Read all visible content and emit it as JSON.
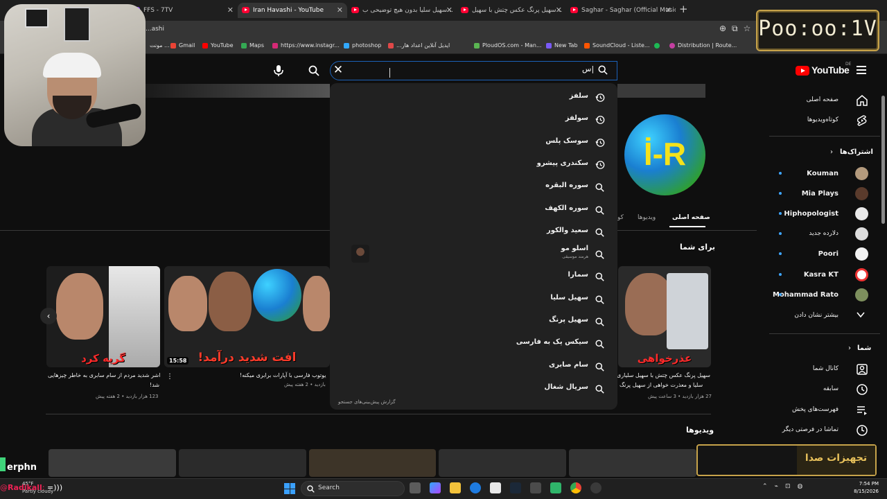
{
  "browser": {
    "tabs": [
      {
        "label": "FFS - 7TV",
        "type": "other"
      },
      {
        "label": "Iran Havashi - YouTube",
        "type": "youtube",
        "active": true
      },
      {
        "label": "سهیل سلیا بدون هیچ توضیحی ب...",
        "type": "youtube"
      },
      {
        "label": "سهیل پرنگ عکس چتش با سهیل...",
        "type": "youtube"
      },
      {
        "label": "Saghar - Saghar (Official Music...",
        "type": "youtube"
      }
    ],
    "url": "...ashi",
    "bookmarks": [
      "مونت ...",
      "Gmail",
      "YouTube",
      "Maps",
      "https://www.instagr...",
      "photoshop",
      "...ایدیل آنلاین اعداد هار",
      "PloudOS.com - Man...",
      "New Tab",
      "SoundCloud - Liste...",
      "",
      "Distribution | Route..."
    ]
  },
  "overlay": {
    "timer": "Poo:oo:1V",
    "sound_box_label": "تجهیزات صدا",
    "chat_name": "erphn",
    "chat_user": "Radikall",
    "chat_msg": "=)))",
    "weather_temp": "45°F",
    "weather_desc": "Partly cloudy"
  },
  "masthead": {
    "logo": "YouTube",
    "logo_region": "DE",
    "search_value": "س|"
  },
  "suggestions": [
    {
      "text": "سلفز",
      "type": "history"
    },
    {
      "text": "سولفز",
      "type": "history"
    },
    {
      "text": "سوسک پلس",
      "type": "history"
    },
    {
      "text": "سکندری پیشرو",
      "type": "history"
    },
    {
      "text": "سوره البقره",
      "type": "search"
    },
    {
      "text": "سوره الکهف",
      "type": "search"
    },
    {
      "text": "سعید والکور",
      "type": "search"
    },
    {
      "text": "اسلو مو",
      "sub": "هرمند موسیقی",
      "type": "search"
    },
    {
      "text": "سمارا",
      "type": "search"
    },
    {
      "text": "سهیل سلیا",
      "type": "search"
    },
    {
      "text": "سهیل پرنگ",
      "type": "search"
    },
    {
      "text": "سیکس پک به فارسی",
      "type": "search"
    },
    {
      "text": "سام صابری",
      "type": "search"
    },
    {
      "text": "سریال شغال",
      "type": "search"
    }
  ],
  "report_link": "گزارش پیش‌بینی‌های جستجو",
  "channel": {
    "avatar_text": "İ-R",
    "tabs": [
      "صفحه اصلی",
      "ویدیوها",
      "کو"
    ],
    "for_you": "برای شما",
    "videos_heading": "ویدیوها",
    "videos": [
      {
        "title": "سهیل پرنگ عکس چتش با سهیل سلیاری",
        "title2": "سلیا و معذرت خواهی از سهیل پرنگ",
        "meta": "27 هزار بازدید • 3 ساعت پیش",
        "caption": "عذرخواهی"
      },
      {
        "title": "یوتوب فارسی با آپارات برابری میکنه!",
        "meta": "بازدید • 2 هفته پیش",
        "caption": "افت شدید درآمد!",
        "duration": "15:58"
      },
      {
        "title": "اشر شدید مردم از سام سابری به خاطر چیزهایی",
        "title2": "شد!",
        "meta": "123 هزار بازدید • 2 هفته پیش",
        "caption": "گریه کرد"
      }
    ]
  },
  "sidebar": {
    "main": [
      {
        "label": "صفحه اصلی",
        "icon": "home-icon"
      },
      {
        "label": "کوتاه‌ویدیوها",
        "icon": "shorts-icon"
      }
    ],
    "subs_heading": "اشتراک‌ها",
    "subs": [
      {
        "label": "Kouman",
        "live": true
      },
      {
        "label": "Mia Plays",
        "live": true
      },
      {
        "label": "Hiphopologist",
        "live": true
      },
      {
        "label": "دلارده جدید",
        "live": true
      },
      {
        "label": "Poori",
        "live": true
      },
      {
        "label": "Kasra KT",
        "live": true
      },
      {
        "label": "Mohammad Rato",
        "live": true
      }
    ],
    "show_more": "بیشتر نشان دادن",
    "you_heading": "شما",
    "you": [
      {
        "label": "کانال شما",
        "icon": "channel-icon"
      },
      {
        "label": "سابقه",
        "icon": "history-icon"
      },
      {
        "label": "فهرست‌های پخش",
        "icon": "playlist-icon"
      },
      {
        "label": "تماشا در فرصتی دیگر",
        "icon": "clock-icon"
      }
    ]
  },
  "taskbar": {
    "search": "Search",
    "time": "7:54 PM",
    "date": "8/15/2026"
  }
}
